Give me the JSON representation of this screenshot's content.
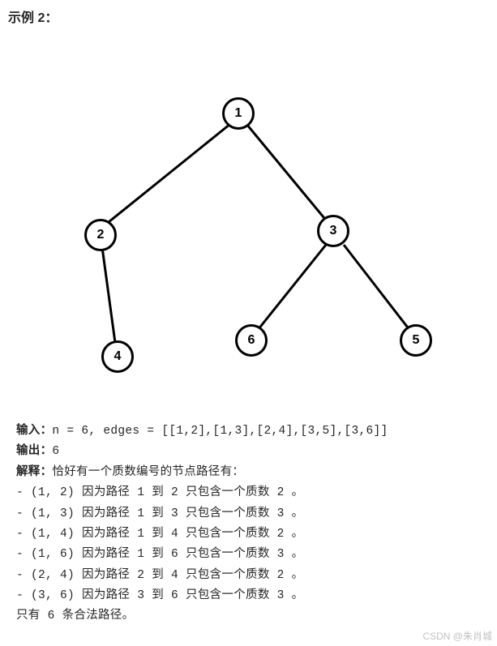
{
  "heading": "示例 2：",
  "nodes": {
    "n1": "1",
    "n2": "2",
    "n3": "3",
    "n4": "4",
    "n5": "5",
    "n6": "6"
  },
  "text": {
    "input_label": "输入：",
    "input_value": "n = 6, edges = [[1,2],[1,3],[2,4],[3,5],[3,6]]",
    "output_label": "输出：",
    "output_value": "6",
    "explain_label": "解释：",
    "explain_value": "恰好有一个质数编号的节点路径有：",
    "p1": "- (1, 2) 因为路径 1 到 2 只包含一个质数 2 。",
    "p2": "- (1, 3) 因为路径 1 到 3 只包含一个质数 3 。",
    "p3": "- (1, 4) 因为路径 1 到 4 只包含一个质数 2 。",
    "p4": "- (1, 6) 因为路径 1 到 6 只包含一个质数 3 。",
    "p5": "- (2, 4) 因为路径 2 到 4 只包含一个质数 2 。",
    "p6": "- (3, 6) 因为路径 3 到 6 只包含一个质数 3 。",
    "final": "只有 6 条合法路径。"
  },
  "watermark": "CSDN @朱肖城",
  "chart_data": {
    "type": "tree",
    "nodes": [
      1,
      2,
      3,
      4,
      5,
      6
    ],
    "edges": [
      [
        1,
        2
      ],
      [
        1,
        3
      ],
      [
        2,
        4
      ],
      [
        3,
        5
      ],
      [
        3,
        6
      ]
    ]
  }
}
